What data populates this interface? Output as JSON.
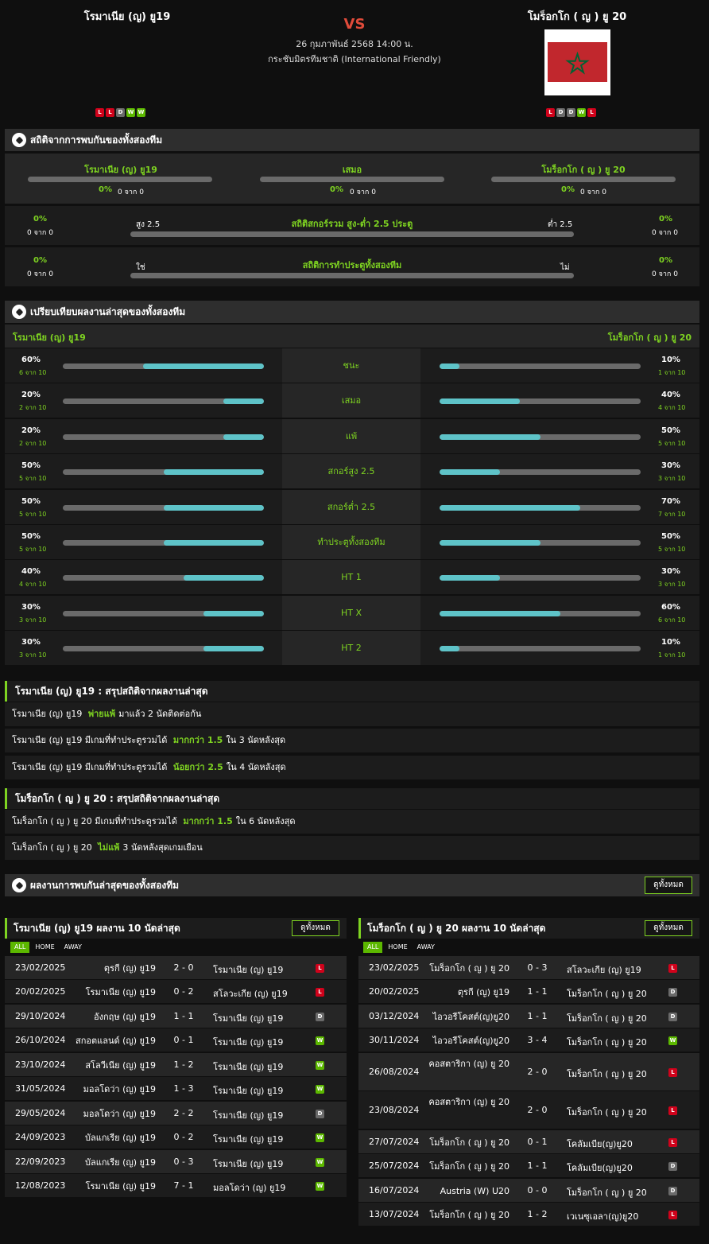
{
  "header": {
    "home": "โรมาเนีย (ญ) ยู19",
    "away": "โมร็อกโก ( ญ ) ยู 20",
    "vs": "VS",
    "date": "26 กุมภาพันธ์ 2568 14:00 น.",
    "competition": "กระชับมิตรทีมชาติ (International Friendly)",
    "home_form": [
      "L",
      "L",
      "D",
      "W",
      "W"
    ],
    "away_form": [
      "L",
      "D",
      "D",
      "W",
      "L"
    ],
    "flag_colors": {
      "red": "#c1272d",
      "green": "#006233"
    }
  },
  "h2h": {
    "title": "สถิติจากการพบกันของทั้งสองทีม",
    "home": "โรมาเนีย (ญ) ยู19",
    "draw": "เสมอ",
    "away": "โมร็อกโก ( ญ ) ยู 20",
    "home_pct": "0%",
    "home_sub": "0 จาก 0",
    "draw_pct": "0%",
    "draw_sub": "0 จาก 0",
    "away_pct": "0%",
    "away_sub": "0 จาก 0",
    "ou": {
      "title": "สถิติสกอร์รวม สูง-ต่ำ 2.5 ประตู",
      "left_label": "สูง 2.5",
      "right_label": "ต่ำ 2.5",
      "left_pct": "0%",
      "left_sub": "0 จาก 0",
      "right_pct": "0%",
      "right_sub": "0 จาก 0"
    },
    "btts": {
      "title": "สถิติการทำประตูทั้งสองทีม",
      "left_label": "ใช่",
      "right_label": "ไม่",
      "left_pct": "0%",
      "left_sub": "0 จาก 0",
      "right_pct": "0%",
      "right_sub": "0 จาก 0"
    }
  },
  "compare": {
    "title": "เปรียบเทียบผลงานล่าสุดของทั้งสองทีม",
    "home": "โรมาเนีย (ญ) ยู19",
    "away": "โมร็อกโก ( ญ ) ยู 20",
    "rows": [
      {
        "label": "ชนะ",
        "l_pct": "60%",
        "l_sub": "6 จาก 10",
        "l_val": 0.6,
        "r_pct": "10%",
        "r_sub": "1 จาก 10",
        "r_val": 0.1
      },
      {
        "label": "เสมอ",
        "l_pct": "20%",
        "l_sub": "2 จาก 10",
        "l_val": 0.2,
        "r_pct": "40%",
        "r_sub": "4 จาก 10",
        "r_val": 0.4
      },
      {
        "label": "แพ้",
        "l_pct": "20%",
        "l_sub": "2 จาก 10",
        "l_val": 0.2,
        "r_pct": "50%",
        "r_sub": "5 จาก 10",
        "r_val": 0.5
      },
      {
        "label": "สกอร์สูง 2.5",
        "l_pct": "50%",
        "l_sub": "5 จาก 10",
        "l_val": 0.5,
        "r_pct": "30%",
        "r_sub": "3 จาก 10",
        "r_val": 0.3
      },
      {
        "label": "สกอร์ต่ำ 2.5",
        "l_pct": "50%",
        "l_sub": "5 จาก 10",
        "l_val": 0.5,
        "r_pct": "70%",
        "r_sub": "7 จาก 10",
        "r_val": 0.7
      },
      {
        "label": "ทำประตูทั้งสองทีม",
        "l_pct": "50%",
        "l_sub": "5 จาก 10",
        "l_val": 0.5,
        "r_pct": "50%",
        "r_sub": "5 จาก 10",
        "r_val": 0.5
      },
      {
        "label": "HT 1",
        "l_pct": "40%",
        "l_sub": "4 จาก 10",
        "l_val": 0.4,
        "r_pct": "30%",
        "r_sub": "3 จาก 10",
        "r_val": 0.3
      },
      {
        "label": "HT X",
        "l_pct": "30%",
        "l_sub": "3 จาก 10",
        "l_val": 0.3,
        "r_pct": "60%",
        "r_sub": "6 จาก 10",
        "r_val": 0.6
      },
      {
        "label": "HT 2",
        "l_pct": "30%",
        "l_sub": "3 จาก 10",
        "l_val": 0.3,
        "r_pct": "10%",
        "r_sub": "1 จาก 10",
        "r_val": 0.1
      }
    ]
  },
  "home_summary": {
    "title": "โรมาเนีย (ญ) ยู19 : สรุปสถิติจากผลงานล่าสุด",
    "lines": [
      {
        "pre": "โรมาเนีย (ญ) ยู19",
        "hl": "พ่ายแพ้",
        "post": "มาแล้ว 2 นัดติดต่อกัน"
      },
      {
        "pre": "โรมาเนีย (ญ) ยู19  มีเกมที่ทำประตูรวมได้",
        "hl": "มากกว่า  1.5",
        "post": "ใน 3 นัดหลังสุด"
      },
      {
        "pre": "โรมาเนีย (ญ) ยู19  มีเกมที่ทำประตูรวมได้",
        "hl": "น้อยกว่า  2.5",
        "post": "ใน 4 นัดหลังสุด"
      }
    ]
  },
  "away_summary": {
    "title": "โมร็อกโก ( ญ ) ยู 20 : สรุปสถิติจากผลงานล่าสุด",
    "lines": [
      {
        "pre": "โมร็อกโก ( ญ ) ยู 20  มีเกมที่ทำประตูรวมได้",
        "hl": "มากกว่า  1.5",
        "post": "ใน 6 นัดหลังสุด"
      },
      {
        "pre": "โมร็อกโก ( ญ ) ยู 20",
        "hl": "ไม่แพ้",
        "post": "3  นัดหลังสุดเกมเยือน"
      }
    ]
  },
  "h2h_results": {
    "title": "ผลงานการพบกันล่าสุดของทั้งสองทีม",
    "view_all": "ดูทั้งหมด"
  },
  "home_last": {
    "title": "โรมาเนีย (ญ) ยู19 ผลงาน 10 นัดล่าสุด",
    "view_all": "ดูทั้งหมด",
    "tabs": [
      "ALL",
      "HOME",
      "AWAY"
    ],
    "matches": [
      {
        "date": "23/02/2025",
        "home": "ตุรกี (ญ) ยู19",
        "score": "2 - 0",
        "away": "โรมาเนีย (ญ) ยู19",
        "res": "L"
      },
      {
        "date": "20/02/2025",
        "home": "โรมาเนีย (ญ) ยู19",
        "score": "0 - 2",
        "away": "สโลวะเกีย (ญ) ยู19",
        "res": "L"
      },
      {
        "date": "29/10/2024",
        "home": "อังกฤษ (ญ) ยู19",
        "score": "1 - 1",
        "away": "โรมาเนีย (ญ) ยู19",
        "res": "D"
      },
      {
        "date": "26/10/2024",
        "home": "สกอตแลนด์ (ญ) ยู19",
        "score": "0 - 1",
        "away": "โรมาเนีย (ญ) ยู19",
        "res": "W"
      },
      {
        "date": "23/10/2024",
        "home": "สโลวีเนีย (ญ) ยู19",
        "score": "1 - 2",
        "away": "โรมาเนีย (ญ) ยู19",
        "res": "W"
      },
      {
        "date": "31/05/2024",
        "home": "มอลโดว่า (ญ) ยู19",
        "score": "1 - 3",
        "away": "โรมาเนีย (ญ) ยู19",
        "res": "W"
      },
      {
        "date": "29/05/2024",
        "home": "มอลโดว่า (ญ) ยู19",
        "score": "2 - 2",
        "away": "โรมาเนีย (ญ) ยู19",
        "res": "D"
      },
      {
        "date": "24/09/2023",
        "home": "บัลแกเรีย (ญ) ยู19",
        "score": "0 - 2",
        "away": "โรมาเนีย (ญ) ยู19",
        "res": "W"
      },
      {
        "date": "22/09/2023",
        "home": "บัลแกเรีย (ญ) ยู19",
        "score": "0 - 3",
        "away": "โรมาเนีย (ญ) ยู19",
        "res": "W"
      },
      {
        "date": "12/08/2023",
        "home": "โรมาเนีย (ญ) ยู19",
        "score": "7 - 1",
        "away": "มอลโดว่า (ญ) ยู19",
        "res": "W"
      }
    ]
  },
  "away_last": {
    "title": "โมร็อกโก ( ญ ) ยู 20 ผลงาน 10 นัดล่าสุด",
    "view_all": "ดูทั้งหมด",
    "tabs": [
      "ALL",
      "HOME",
      "AWAY"
    ],
    "matches": [
      {
        "date": "23/02/2025",
        "home": "โมร็อกโก ( ญ ) ยู 20",
        "score": "0 - 3",
        "away": "สโลวะเกีย (ญ) ยู19",
        "res": "L"
      },
      {
        "date": "20/02/2025",
        "home": "ตุรกี (ญ) ยู19",
        "score": "1 - 1",
        "away": "โมร็อกโก ( ญ ) ยู 20",
        "res": "D"
      },
      {
        "date": "03/12/2024",
        "home": "ไอวอรีโคสต์(ญ)ยู20",
        "score": "1 - 1",
        "away": "โมร็อกโก ( ญ ) ยู 20",
        "res": "D"
      },
      {
        "date": "30/11/2024",
        "home": "ไอวอรีโคสต์(ญ)ยู20",
        "score": "3 - 4",
        "away": "โมร็อกโก ( ญ ) ยู 20",
        "res": "W"
      },
      {
        "date": "26/08/2024",
        "home": "คอสตาริกา (ญ) ยู 20",
        "score": "2 - 0",
        "away": "โมร็อกโก ( ญ ) ยู 20",
        "res": "L"
      },
      {
        "date": "23/08/2024",
        "home": "คอสตาริกา (ญ) ยู 20",
        "score": "2 - 0",
        "away": "โมร็อกโก ( ญ ) ยู 20",
        "res": "L"
      },
      {
        "date": "27/07/2024",
        "home": "โมร็อกโก ( ญ ) ยู 20",
        "score": "0 - 1",
        "away": "โคลัมเบีย(ญ)ยู20",
        "res": "L"
      },
      {
        "date": "25/07/2024",
        "home": "โมร็อกโก ( ญ ) ยู 20",
        "score": "1 - 1",
        "away": "โคลัมเบีย(ญ)ยู20",
        "res": "D"
      },
      {
        "date": "16/07/2024",
        "home": "Austria (W) U20",
        "score": "0 - 0",
        "away": "โมร็อกโก ( ญ ) ยู 20",
        "res": "D"
      },
      {
        "date": "13/07/2024",
        "home": "โมร็อกโก ( ญ ) ยู 20",
        "score": "1 - 2",
        "away": "เวเนซุเอลา(ญ)ยู20",
        "res": "L"
      }
    ]
  }
}
